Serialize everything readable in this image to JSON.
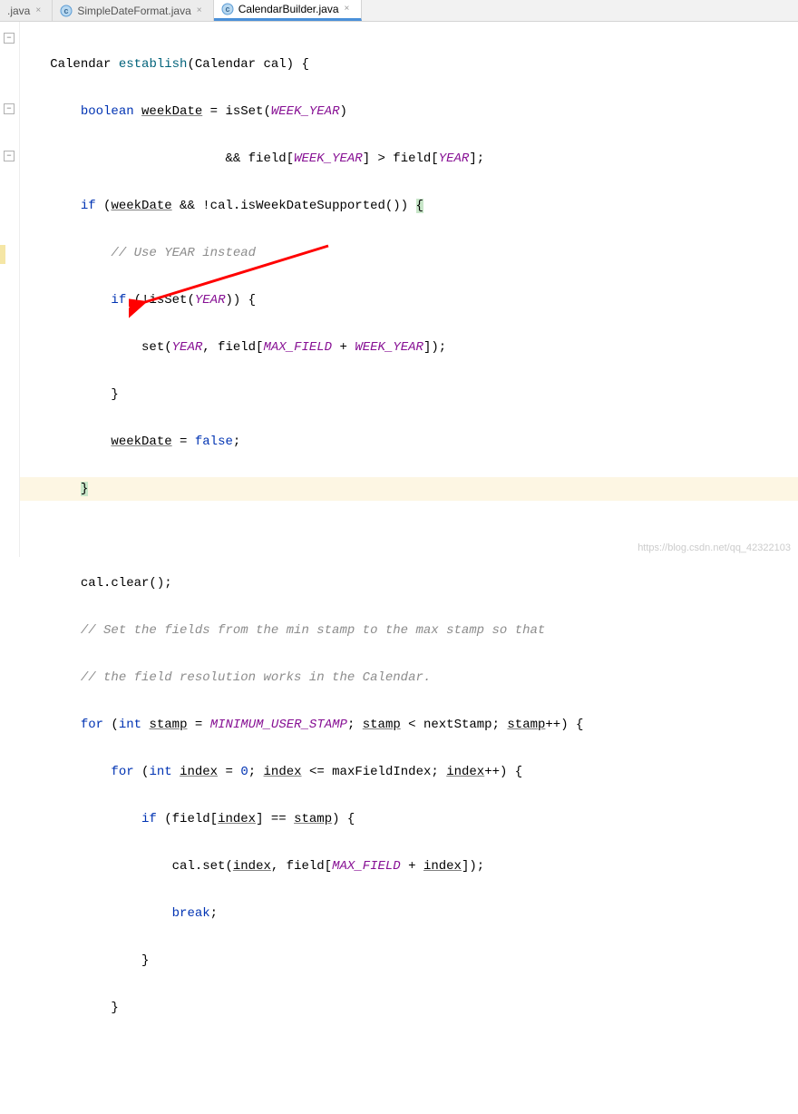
{
  "tabs": [
    {
      "label": ".java",
      "icon": ""
    },
    {
      "label": "SimpleDateFormat.java",
      "icon": "c"
    },
    {
      "label": "CalendarBuilder.java",
      "icon": "c",
      "active": true
    }
  ],
  "code": {
    "l1": {
      "t1": "Calendar ",
      "fn": "establish",
      "t2": "(Calendar cal) {"
    },
    "l2": {
      "kw": "boolean",
      "sp": " ",
      "var": "weekDate",
      "t1": " = isSet(",
      "id": "WEEK_YEAR",
      "t2": ")"
    },
    "l3": {
      "t1": "&& field[",
      "id1": "WEEK_YEAR",
      "t2": "] > field[",
      "id2": "YEAR",
      "t3": "];"
    },
    "l4": {
      "kw": "if",
      "t1": " (",
      "var": "weekDate",
      "t2": " && !cal.isWeekDateSupported()) ",
      "br": "{"
    },
    "l5": {
      "cm": "// Use YEAR instead"
    },
    "l6": {
      "kw": "if",
      "t1": " (!isSet(",
      "id": "YEAR",
      "t2": ")) {"
    },
    "l7": {
      "t1": "set(",
      "id1": "YEAR",
      "t2": ", field[",
      "id2": "MAX_FIELD",
      "t3": " + ",
      "id3": "WEEK_YEAR",
      "t4": "]);"
    },
    "l8": {
      "t1": "}"
    },
    "l9": {
      "var": "weekDate",
      "t1": " = ",
      "kw": "false",
      "t2": ";"
    },
    "l10": {
      "br": "}"
    },
    "l11": {
      "t1": ""
    },
    "l12": {
      "t1": "cal.clear();"
    },
    "l13": {
      "cm": "// Set the fields from the min stamp to the max stamp so that"
    },
    "l14": {
      "cm": "// the field resolution works in the Calendar."
    },
    "l15": {
      "kw1": "for",
      "t1": " (",
      "kw2": "int",
      "t2": " ",
      "v1": "stamp",
      "t3": " = ",
      "id": "MINIMUM_USER_STAMP",
      "t4": "; ",
      "v2": "stamp",
      "t5": " < nextStamp; ",
      "v3": "stamp",
      "t6": "++) {"
    },
    "l16": {
      "kw1": "for",
      "t1": " (",
      "kw2": "int",
      "t2": " ",
      "v1": "index",
      "t3": " = ",
      "num": "0",
      "t4": "; ",
      "v2": "index",
      "t5": " <= maxFieldIndex; ",
      "v3": "index",
      "t6": "++) {"
    },
    "l17": {
      "kw": "if",
      "t1": " (field[",
      "v1": "index",
      "t2": "] == ",
      "v2": "stamp",
      "t3": ") {"
    },
    "l18": {
      "t1": "cal.set(",
      "v1": "index",
      "t2": ", field[",
      "id": "MAX_FIELD",
      "t3": " + ",
      "v2": "index",
      "t4": "]);"
    },
    "l19": {
      "kw": "break",
      "t1": ";"
    },
    "l20": {
      "t1": "}"
    },
    "l21": {
      "t1": "}"
    }
  },
  "watermark": "https://blog.csdn.net/qq_42322103"
}
